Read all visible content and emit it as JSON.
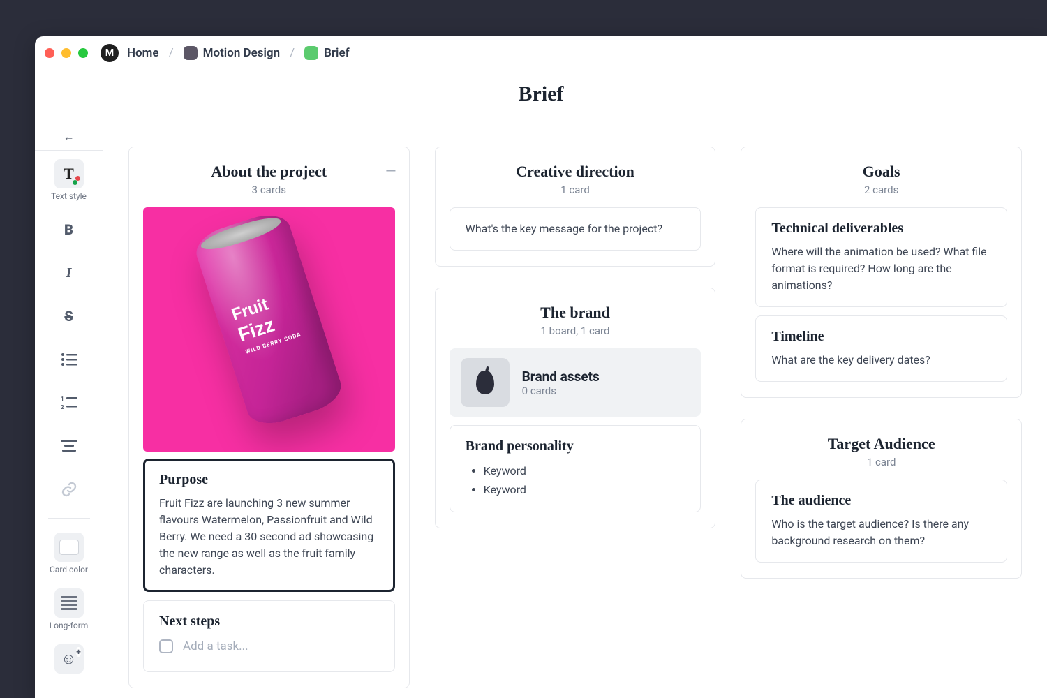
{
  "breadcrumbs": {
    "home": "Home",
    "project": {
      "label": "Motion Design",
      "swatch": "#5C5766"
    },
    "page": {
      "label": "Brief",
      "swatch": "#5BCB6E"
    }
  },
  "page_title": "Brief",
  "toolbar": {
    "text_style_label": "Text style",
    "card_color_label": "Card color",
    "long_form_label": "Long-form"
  },
  "columns": {
    "about": {
      "title": "About the project",
      "count": "3 cards",
      "hero_product": {
        "line1": "Fruit",
        "line2": "Fizz",
        "sub": "WILD BERRY SODA"
      },
      "purpose": {
        "title": "Purpose",
        "body": "Fruit Fizz are launching 3 new summer flavours Watermelon, Passionfruit and Wild Berry. We need a 30 second ad showcasing the new range as well as the fruit family characters."
      },
      "next_steps": {
        "title": "Next steps",
        "placeholder": "Add a task..."
      }
    },
    "creative": {
      "title": "Creative direction",
      "count": "1 card",
      "card_body": "What's the key message for the project?"
    },
    "brand": {
      "title": "The brand",
      "count": "1 board, 1 card",
      "board": {
        "title": "Brand assets",
        "count": "0 cards"
      },
      "personality": {
        "title": "Brand personality",
        "items": [
          "Keyword",
          "Keyword"
        ]
      }
    },
    "goals": {
      "title": "Goals",
      "count": "2 cards",
      "tech": {
        "title": "Technical deliverables",
        "body": "Where will the animation be used? What file format is required? How long are the animations?"
      },
      "timeline": {
        "title": "Timeline",
        "body": "What are the key delivery dates?"
      }
    },
    "audience": {
      "title": "Target Audience",
      "count": "1 card",
      "card": {
        "title": "The audience",
        "body": "Who is the target audience? Is there any background research on them?"
      }
    }
  }
}
